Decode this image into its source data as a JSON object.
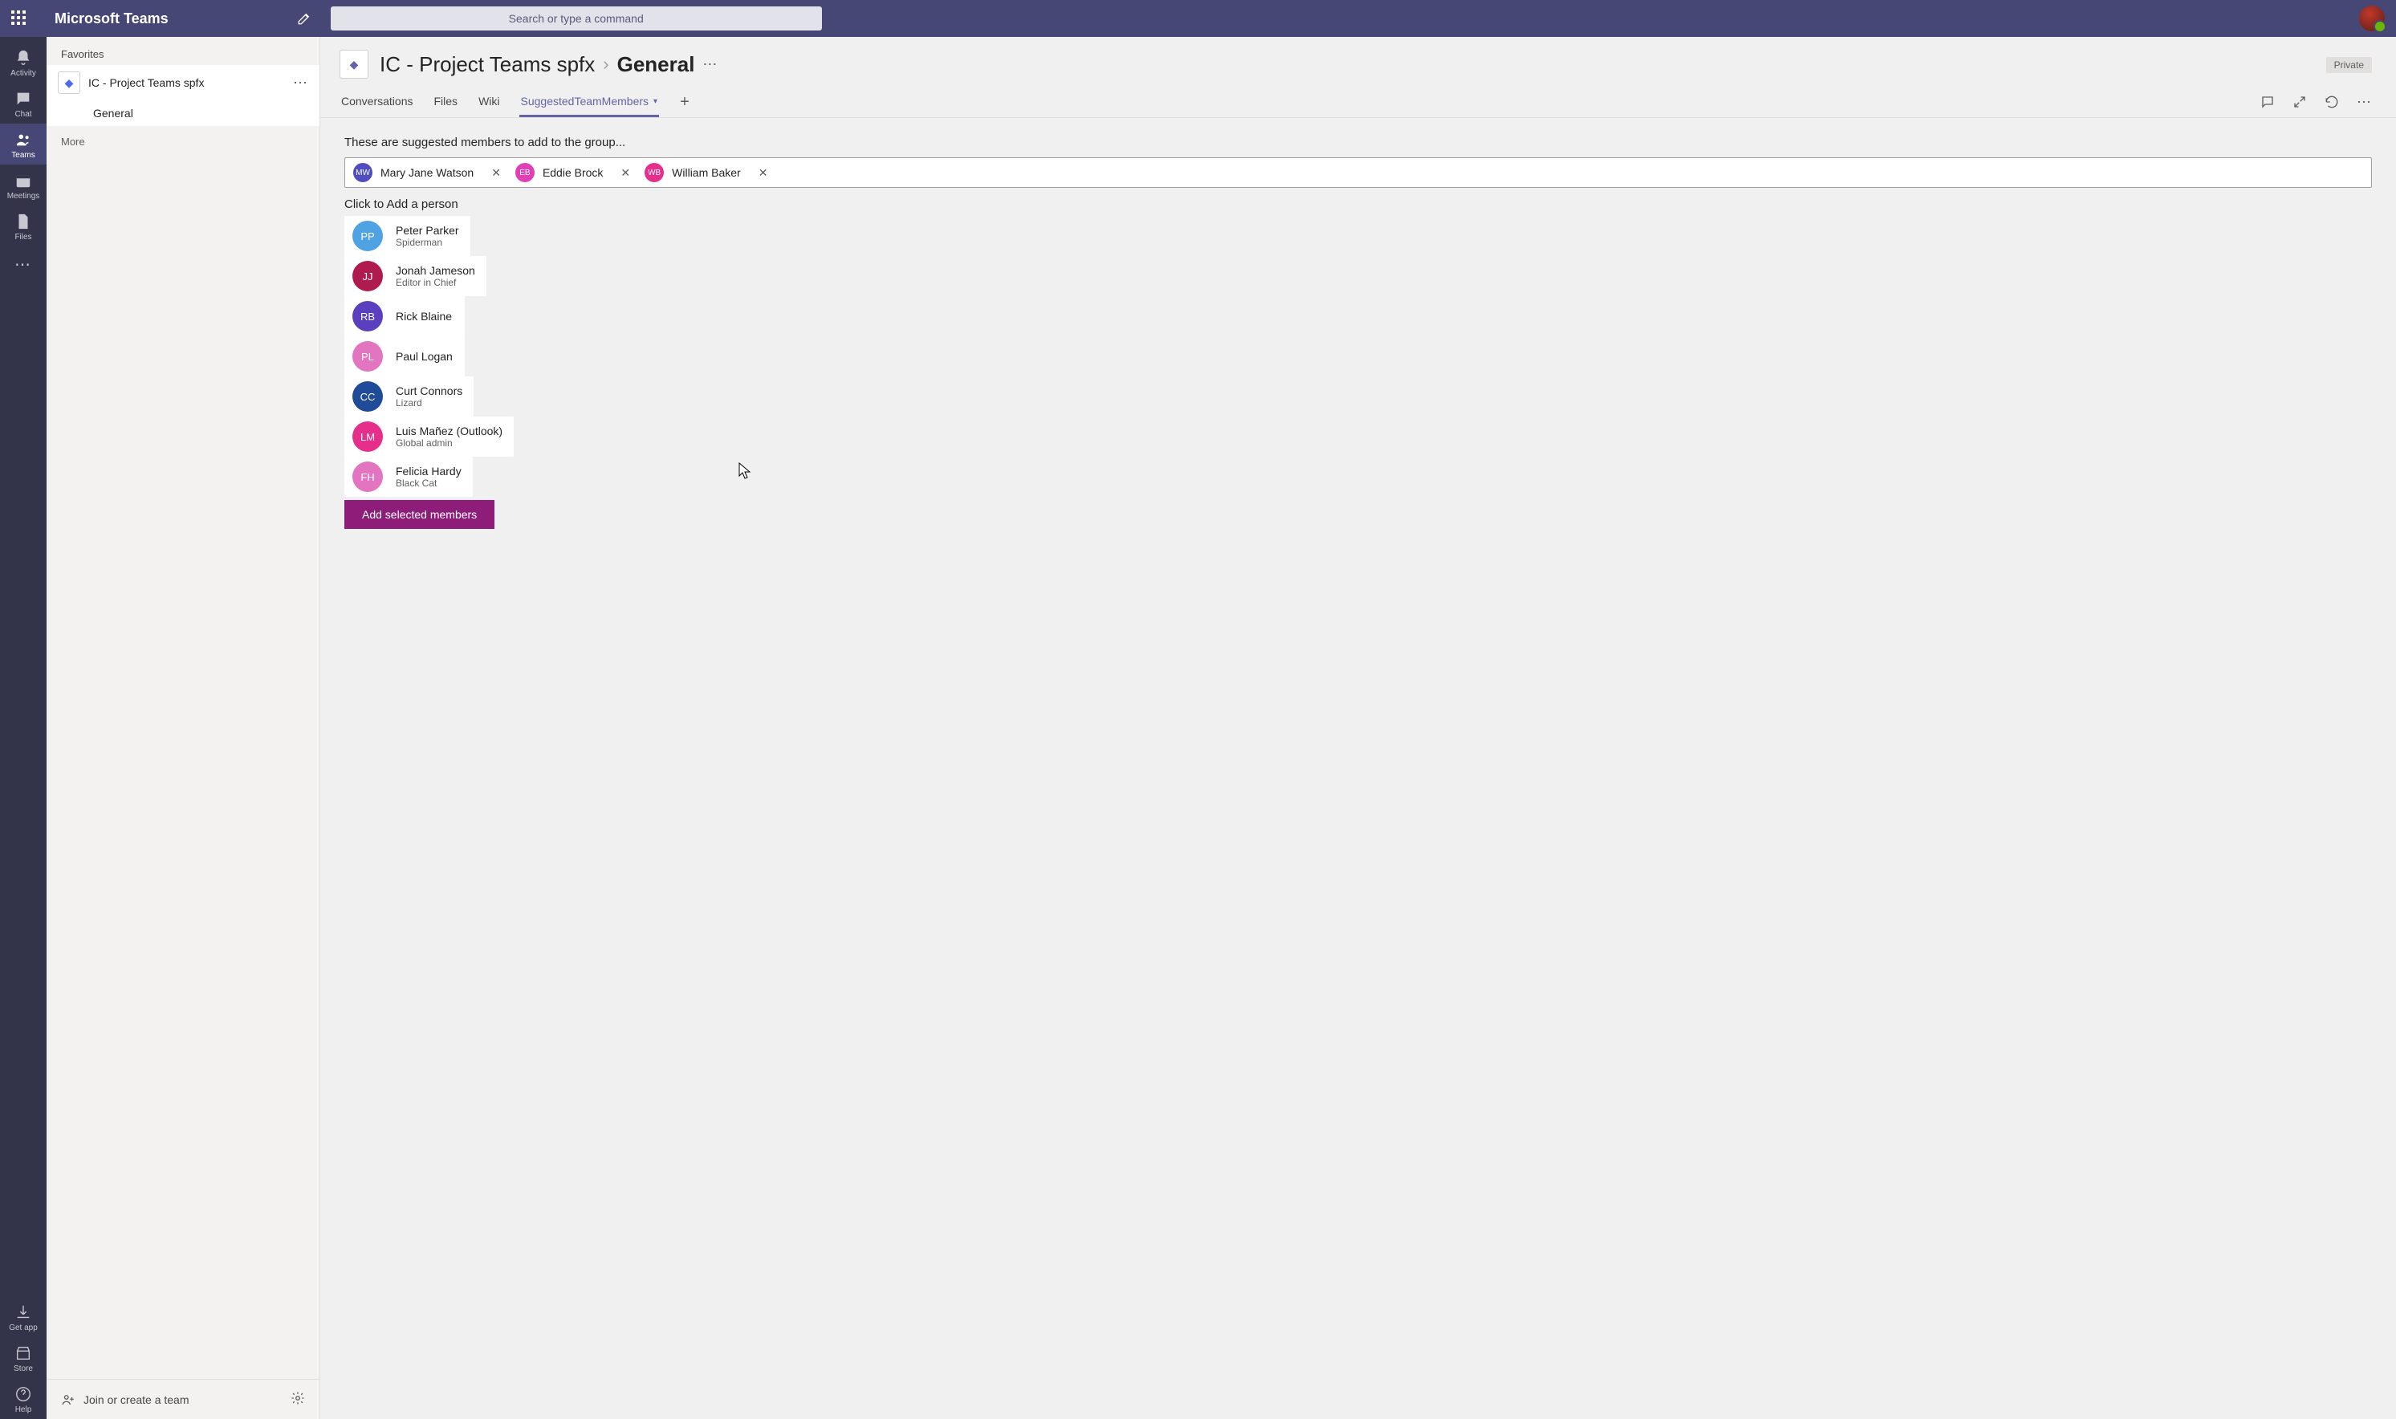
{
  "app": {
    "title": "Microsoft Teams"
  },
  "search": {
    "placeholder": "Search or type a command"
  },
  "rail": {
    "items": [
      {
        "id": "activity",
        "label": "Activity"
      },
      {
        "id": "chat",
        "label": "Chat"
      },
      {
        "id": "teams",
        "label": "Teams",
        "active": true
      },
      {
        "id": "meetings",
        "label": "Meetings"
      },
      {
        "id": "files",
        "label": "Files"
      }
    ],
    "bottom": [
      {
        "id": "getapp",
        "label": "Get app"
      },
      {
        "id": "store",
        "label": "Store"
      },
      {
        "id": "help",
        "label": "Help"
      }
    ]
  },
  "leftPanel": {
    "section": "Favorites",
    "team": {
      "name": "IC - Project Teams spfx"
    },
    "channel": "General",
    "more": "More",
    "footer": {
      "join": "Join or create a team"
    }
  },
  "header": {
    "team": "IC - Project Teams spfx",
    "channel": "General",
    "privacy": "Private"
  },
  "tabs": [
    {
      "id": "conversations",
      "label": "Conversations"
    },
    {
      "id": "files",
      "label": "Files"
    },
    {
      "id": "wiki",
      "label": "Wiki"
    },
    {
      "id": "suggested",
      "label": "SuggestedTeamMembers",
      "active": true,
      "hasDropdown": true
    }
  ],
  "content": {
    "intro": "These are suggested members to add to the group...",
    "selected": [
      {
        "initials": "MW",
        "name": "Mary Jane Watson",
        "color": "#4f4dbf"
      },
      {
        "initials": "EB",
        "name": "Eddie Brock",
        "color": "#e03fb5"
      },
      {
        "initials": "WB",
        "name": "William Baker",
        "color": "#e62e8b"
      }
    ],
    "hint": "Click to Add a person",
    "suggestions": [
      {
        "initials": "PP",
        "name": "Peter Parker",
        "sub": "Spiderman",
        "color": "#4fa3e3"
      },
      {
        "initials": "JJ",
        "name": "Jonah Jameson",
        "sub": "Editor in Chief",
        "color": "#b01b4f"
      },
      {
        "initials": "RB",
        "name": "Rick Blaine",
        "sub": "",
        "color": "#5a3fbf"
      },
      {
        "initials": "PL",
        "name": "Paul Logan",
        "sub": "",
        "color": "#e374c0"
      },
      {
        "initials": "CC",
        "name": "Curt Connors",
        "sub": "Lizard",
        "color": "#1f4b99"
      },
      {
        "initials": "LM",
        "name": "Luis Mañez (Outlook)",
        "sub": "Global admin",
        "color": "#e62e8b"
      },
      {
        "initials": "FH",
        "name": "Felicia Hardy",
        "sub": "Black Cat",
        "color": "#e374c0"
      }
    ],
    "addButton": "Add selected members"
  }
}
